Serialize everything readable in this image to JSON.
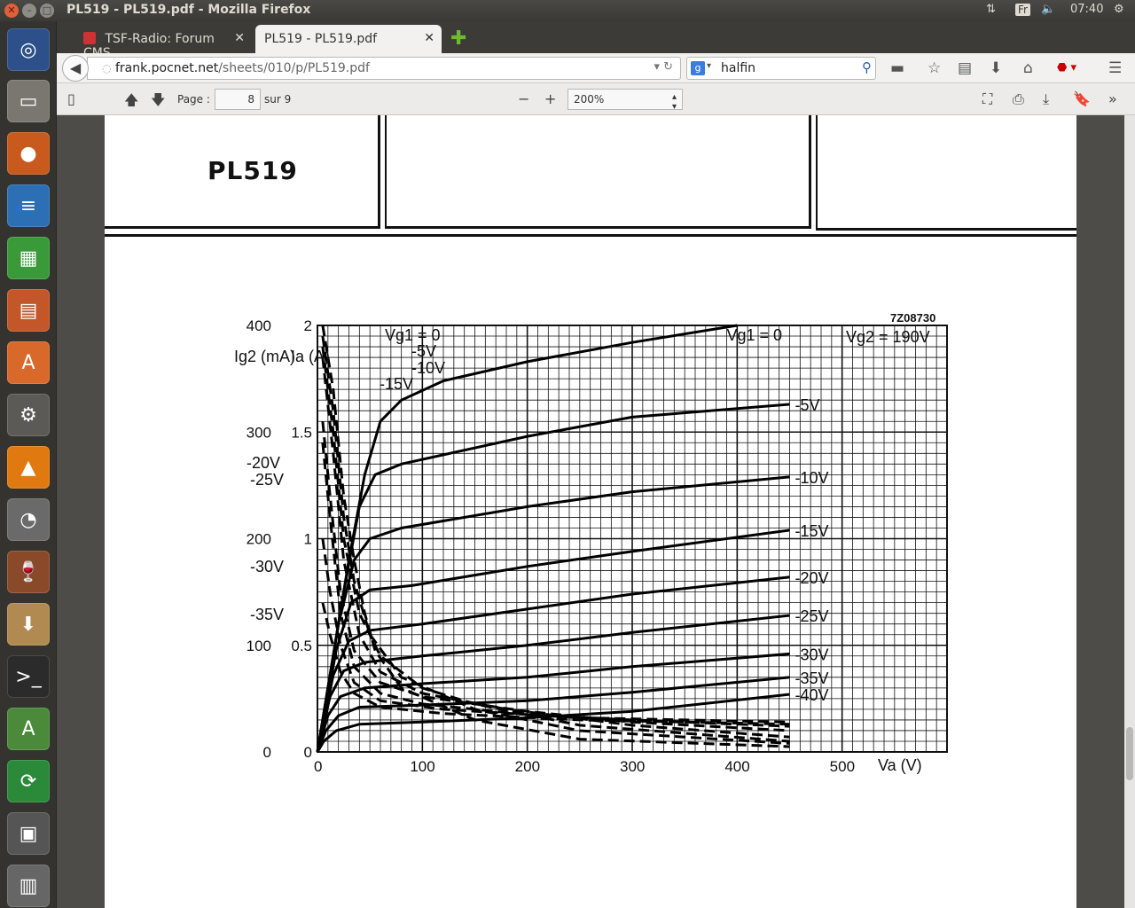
{
  "window": {
    "title": "PL519 - PL519.pdf - Mozilla Firefox",
    "tray_lang": "Fr",
    "clock": "07:40"
  },
  "tabs": [
    {
      "label": "TSF-Radio: Forum CMS",
      "active": false
    },
    {
      "label": "PL519 - PL519.pdf",
      "active": true
    }
  ],
  "nav": {
    "url_domain": "frank.pocnet.net",
    "url_path": "/sheets/010/p/PL519.pdf",
    "search_value": "halfin"
  },
  "pdf_toolbar": {
    "page_label": "Page :",
    "page_number": "8",
    "page_total": "sur 9",
    "zoom": "200%"
  },
  "document": {
    "title": "PL519",
    "figure_code": "7Z08730"
  },
  "chart_data": {
    "type": "line",
    "xlabel": "Va (V)",
    "ylabel_left": "Ig2 (mA)",
    "ylabel_right": "Ia (A)",
    "xlim": [
      0,
      600
    ],
    "ylim_ia": [
      0,
      2
    ],
    "ylim_ig2": [
      0,
      400
    ],
    "x_ticks": [
      "0",
      "100",
      "200",
      "300",
      "400",
      "500"
    ],
    "ia_ticks": [
      "0",
      "0.5",
      "1",
      "1.5",
      "2"
    ],
    "ig2_ticks": [
      "0",
      "100",
      "200",
      "300",
      "400"
    ],
    "condition": "Vg2 = 190V",
    "series_ia": [
      {
        "name": "Vg1 = 0",
        "points": [
          [
            0,
            0
          ],
          [
            30,
            0.9
          ],
          [
            45,
            1.3
          ],
          [
            60,
            1.55
          ],
          [
            80,
            1.65
          ],
          [
            120,
            1.74
          ],
          [
            200,
            1.83
          ],
          [
            300,
            1.92
          ],
          [
            400,
            2.0
          ]
        ]
      },
      {
        "name": "-5V",
        "points": [
          [
            0,
            0
          ],
          [
            25,
            0.75
          ],
          [
            40,
            1.15
          ],
          [
            55,
            1.3
          ],
          [
            80,
            1.35
          ],
          [
            200,
            1.48
          ],
          [
            300,
            1.57
          ],
          [
            450,
            1.63
          ]
        ]
      },
      {
        "name": "-10V",
        "points": [
          [
            0,
            0
          ],
          [
            20,
            0.6
          ],
          [
            35,
            0.9
          ],
          [
            50,
            1.0
          ],
          [
            80,
            1.05
          ],
          [
            200,
            1.15
          ],
          [
            300,
            1.22
          ],
          [
            450,
            1.29
          ]
        ]
      },
      {
        "name": "-15V",
        "points": [
          [
            0,
            0
          ],
          [
            18,
            0.48
          ],
          [
            32,
            0.7
          ],
          [
            50,
            0.76
          ],
          [
            90,
            0.78
          ],
          [
            200,
            0.87
          ],
          [
            300,
            0.94
          ],
          [
            450,
            1.04
          ]
        ]
      },
      {
        "name": "-20V",
        "points": [
          [
            0,
            0
          ],
          [
            15,
            0.36
          ],
          [
            30,
            0.52
          ],
          [
            50,
            0.57
          ],
          [
            100,
            0.6
          ],
          [
            200,
            0.67
          ],
          [
            300,
            0.74
          ],
          [
            450,
            0.82
          ]
        ]
      },
      {
        "name": "-25V",
        "points": [
          [
            0,
            0
          ],
          [
            12,
            0.26
          ],
          [
            25,
            0.38
          ],
          [
            45,
            0.42
          ],
          [
            100,
            0.45
          ],
          [
            200,
            0.5
          ],
          [
            300,
            0.56
          ],
          [
            450,
            0.64
          ]
        ]
      },
      {
        "name": "-30V",
        "points": [
          [
            0,
            0
          ],
          [
            10,
            0.17
          ],
          [
            22,
            0.26
          ],
          [
            45,
            0.3
          ],
          [
            100,
            0.32
          ],
          [
            200,
            0.35
          ],
          [
            300,
            0.4
          ],
          [
            450,
            0.46
          ]
        ]
      },
      {
        "name": "-35V",
        "points": [
          [
            0,
            0
          ],
          [
            8,
            0.1
          ],
          [
            20,
            0.17
          ],
          [
            40,
            0.21
          ],
          [
            100,
            0.22
          ],
          [
            200,
            0.24
          ],
          [
            300,
            0.28
          ],
          [
            450,
            0.35
          ]
        ]
      },
      {
        "name": "-40V",
        "points": [
          [
            0,
            0
          ],
          [
            6,
            0.05
          ],
          [
            18,
            0.1
          ],
          [
            40,
            0.13
          ],
          [
            100,
            0.14
          ],
          [
            200,
            0.16
          ],
          [
            300,
            0.19
          ],
          [
            450,
            0.27
          ]
        ]
      }
    ],
    "series_ig2": [
      {
        "name": "Vg1 = 0",
        "points": [
          [
            5,
            400
          ],
          [
            15,
            340
          ],
          [
            25,
            240
          ],
          [
            35,
            180
          ],
          [
            45,
            130
          ],
          [
            55,
            95
          ],
          [
            80,
            60
          ],
          [
            150,
            30
          ],
          [
            250,
            12
          ],
          [
            450,
            5
          ]
        ]
      },
      {
        "name": "-5V",
        "points": [
          [
            5,
            390
          ],
          [
            15,
            320
          ],
          [
            25,
            220
          ],
          [
            35,
            160
          ],
          [
            50,
            110
          ],
          [
            80,
            70
          ],
          [
            150,
            40
          ],
          [
            250,
            20
          ],
          [
            450,
            8
          ]
        ]
      },
      {
        "name": "-10V",
        "points": [
          [
            5,
            380
          ],
          [
            15,
            300
          ],
          [
            25,
            200
          ],
          [
            40,
            130
          ],
          [
            60,
            90
          ],
          [
            100,
            60
          ],
          [
            150,
            45
          ],
          [
            250,
            25
          ],
          [
            450,
            10
          ]
        ]
      },
      {
        "name": "-15V",
        "points": [
          [
            5,
            370
          ],
          [
            15,
            280
          ],
          [
            25,
            180
          ],
          [
            40,
            110
          ],
          [
            60,
            75
          ],
          [
            100,
            55
          ],
          [
            180,
            40
          ],
          [
            300,
            25
          ],
          [
            450,
            14
          ]
        ]
      },
      {
        "name": "-20V",
        "points": [
          [
            5,
            310
          ],
          [
            12,
            240
          ],
          [
            22,
            150
          ],
          [
            35,
            95
          ],
          [
            60,
            65
          ],
          [
            100,
            52
          ],
          [
            200,
            38
          ],
          [
            300,
            28
          ],
          [
            450,
            20
          ]
        ]
      },
      {
        "name": "-25V",
        "points": [
          [
            5,
            290
          ],
          [
            12,
            220
          ],
          [
            22,
            130
          ],
          [
            35,
            80
          ],
          [
            60,
            55
          ],
          [
            100,
            45
          ],
          [
            200,
            35
          ],
          [
            300,
            30
          ],
          [
            450,
            24
          ]
        ]
      },
      {
        "name": "-30V",
        "points": [
          [
            5,
            200
          ],
          [
            12,
            150
          ],
          [
            22,
            100
          ],
          [
            35,
            65
          ],
          [
            60,
            48
          ],
          [
            120,
            40
          ],
          [
            250,
            32
          ],
          [
            450,
            28
          ]
        ]
      },
      {
        "name": "-35V",
        "points": [
          [
            5,
            140
          ],
          [
            12,
            110
          ],
          [
            22,
            75
          ],
          [
            35,
            55
          ],
          [
            60,
            42
          ],
          [
            120,
            36
          ],
          [
            250,
            30
          ],
          [
            450,
            26
          ]
        ]
      }
    ],
    "labels_ia": [
      "Vg1 = 0",
      "-5V",
      "-10V",
      "-15V",
      "-20V",
      "-25V",
      "-30V",
      "-35V",
      "-40V"
    ],
    "labels_ig2_top": [
      "Vg1 = 0",
      "-5V",
      "-10V",
      "-15V"
    ],
    "labels_ig2_left": [
      "-20V",
      "-25V",
      "-30V",
      "-35V"
    ],
    "grid": true,
    "legend": "inline labels"
  }
}
